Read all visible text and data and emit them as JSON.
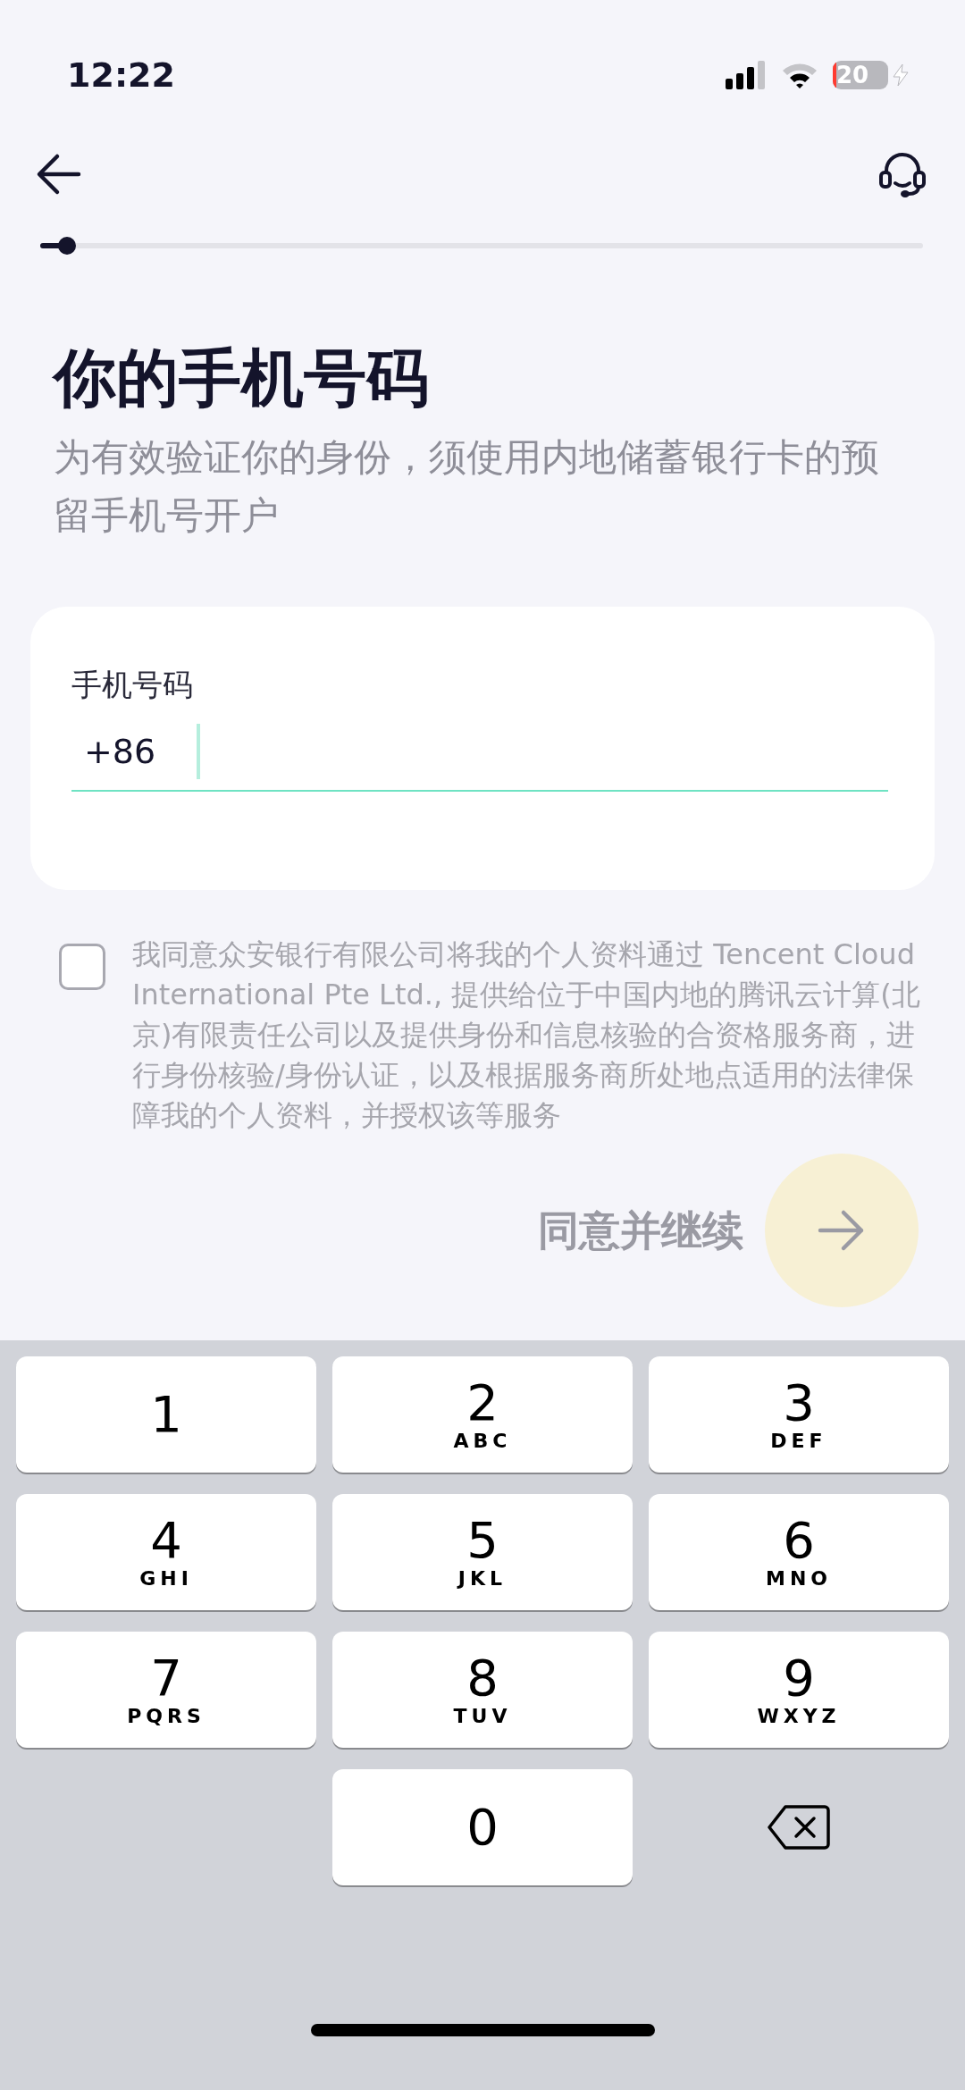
{
  "status_bar": {
    "time": "12:22",
    "battery": "20"
  },
  "progress": {
    "level": 0.03
  },
  "title": "你的手机号码",
  "subtitle": "为有效验证你的身份，须使用内地储蓄银行卡的预留手机号开户",
  "phone_field": {
    "label": "手机号码",
    "prefix": "+86",
    "focused": true
  },
  "consent": {
    "checked": false,
    "text": "我同意众安银行有限公司将我的个人资料通过 Tencent Cloud International Pte Ltd., 提供给位于中国内地的腾讯云计算(北京)有限责任公司以及提供身份和信息核验的合资格服务商，进行身份核验/身份认证，以及根据服务商所处地点适用的法律保障我的个人资料，并授权该等服务"
  },
  "continue_button": {
    "label": "同意并继续",
    "disabled": true
  },
  "keypad": [
    {
      "kind": "digit",
      "digit": "1"
    },
    {
      "kind": "digit",
      "digit": "2",
      "letters": "ABC"
    },
    {
      "kind": "digit",
      "digit": "3",
      "letters": "DEF"
    },
    {
      "kind": "digit",
      "digit": "4",
      "letters": "GHI"
    },
    {
      "kind": "digit",
      "digit": "5",
      "letters": "JKL"
    },
    {
      "kind": "digit",
      "digit": "6",
      "letters": "MNO"
    },
    {
      "kind": "digit",
      "digit": "7",
      "letters": "PQRS"
    },
    {
      "kind": "digit",
      "digit": "8",
      "letters": "TUV"
    },
    {
      "kind": "digit",
      "digit": "9",
      "letters": "WXYZ"
    },
    {
      "kind": "digit",
      "digit": "0"
    },
    {
      "kind": "delete"
    }
  ]
}
